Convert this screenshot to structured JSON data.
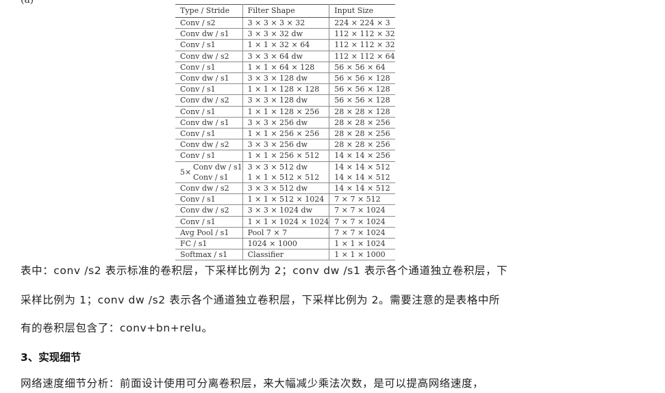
{
  "fragment": "(a)",
  "table": {
    "headers": [
      "Type / Stride",
      "Filter Shape",
      "Input Size"
    ],
    "rows": [
      [
        "Conv / s2",
        "3 × 3 × 3 × 32",
        "224 × 224 × 3"
      ],
      [
        "Conv dw / s1",
        "3 × 3 × 32 dw",
        "112 × 112 × 32"
      ],
      [
        "Conv / s1",
        "1 × 1 × 32 × 64",
        "112 × 112 × 32"
      ],
      [
        "Conv dw / s2",
        "3 × 3 × 64 dw",
        "112 × 112 × 64"
      ],
      [
        "Conv / s1",
        "1 × 1 × 64 × 128",
        "56 × 56 × 64"
      ],
      [
        "Conv dw / s1",
        "3 × 3 × 128 dw",
        "56 × 56 × 128"
      ],
      [
        "Conv / s1",
        "1 × 1 × 128 × 128",
        "56 × 56 × 128"
      ],
      [
        "Conv dw / s2",
        "3 × 3 × 128 dw",
        "56 × 56 × 128"
      ],
      [
        "Conv / s1",
        "1 × 1 × 128 × 256",
        "28 × 28 × 128"
      ],
      [
        "Conv dw / s1",
        "3 × 3 × 256 dw",
        "28 × 28 × 256"
      ],
      [
        "Conv / s1",
        "1 × 1 × 256 × 256",
        "28 × 28 × 256"
      ],
      [
        "Conv dw / s2",
        "3 × 3 × 256 dw",
        "28 × 28 × 256"
      ],
      [
        "Conv / s1",
        "1 × 1 × 256 × 512",
        "14 × 14 × 256"
      ]
    ],
    "repeat_row": {
      "multiplier": "5×",
      "types": [
        "Conv dw / s1",
        "Conv / s1"
      ],
      "filters": [
        "3 × 3 × 512 dw",
        "1 × 1 × 512 × 512"
      ],
      "inputs": [
        "14 × 14 × 512",
        "14 × 14 × 512"
      ]
    },
    "rows_after": [
      [
        "Conv dw / s2",
        "3 × 3 × 512 dw",
        "14 × 14 × 512"
      ],
      [
        "Conv / s1",
        "1 × 1 × 512 × 1024",
        "7 × 7 × 512"
      ],
      [
        "Conv dw / s2",
        "3 × 3 × 1024 dw",
        "7 × 7 × 1024"
      ],
      [
        "Conv / s1",
        "1 × 1 × 1024 × 1024",
        "7 × 7 × 1024"
      ],
      [
        "Avg Pool / s1",
        "Pool 7 × 7",
        "7 × 7 × 1024"
      ],
      [
        "FC / s1",
        "1024 × 1000",
        "1 × 1 × 1024"
      ],
      [
        "Softmax / s1",
        "Classifier",
        "1 × 1 × 1000"
      ]
    ]
  },
  "paragraphs": {
    "p1": "表中：conv /s2 表示标准的卷积层，下采样比例为 2；conv dw /s1  表示各个通道独立卷积层，下",
    "p2": "采样比例为 1；conv dw /s2 表示各个通道独立卷积层，下采样比例为 2。需要注意的是表格中所",
    "p3": "有的卷积层包含了：conv+bn+relu。",
    "heading": "3、实现细节",
    "p4": "网络速度细节分析：前面设计使用可分离卷积层，来大幅减少乘法次数，是可以提高网络速度，"
  }
}
